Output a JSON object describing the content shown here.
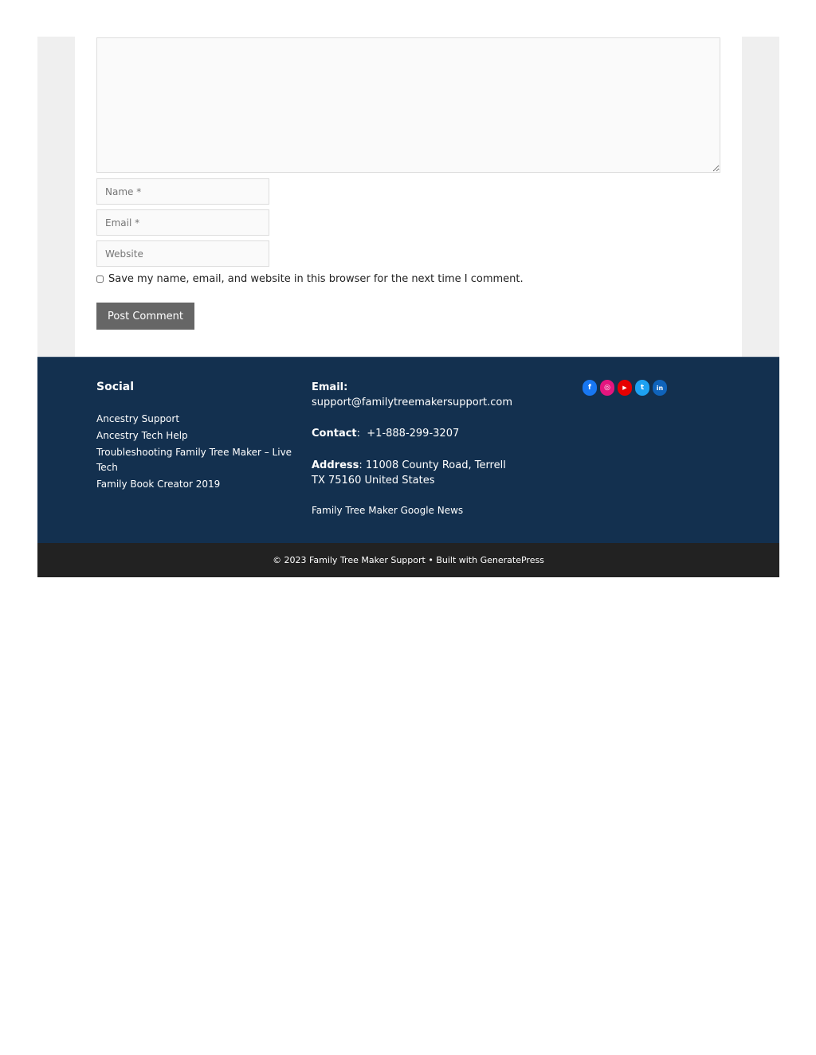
{
  "comment_form": {
    "comment_placeholder": "",
    "name_placeholder": "Name *",
    "email_placeholder": "Email *",
    "website_placeholder": "Website",
    "consent_label": "Save my name, email, and website in this browser for the next time I comment.",
    "submit_label": "Post Comment"
  },
  "footer": {
    "social": {
      "title": "Social",
      "links": [
        "Ancestry Support",
        "Ancestry Tech Help",
        "Troubleshooting Family Tree Maker – Live Tech",
        "Family Book Creator 2019"
      ]
    },
    "contact": {
      "email_label": "Email:",
      "email_value": "support@familytreemakersupport.com",
      "contact_label": "Contact",
      "contact_value": ":  +1-888-299-3207",
      "address_label": "Address",
      "address_line1": ": 11008 County Road, Terrell",
      "address_line2": "TX 75160 United States",
      "news_link": "Family Tree Maker Google News"
    },
    "social_icons": [
      {
        "name": "facebook-icon",
        "glyph": "f",
        "color": "#1877f2"
      },
      {
        "name": "instagram-icon",
        "glyph": "◎",
        "color": "#e4157f"
      },
      {
        "name": "youtube-icon",
        "glyph": "▶",
        "color": "#e60000"
      },
      {
        "name": "twitter-icon",
        "glyph": "t",
        "color": "#1da1f2"
      },
      {
        "name": "linkedin-icon",
        "glyph": "in",
        "color": "#0f63bb"
      }
    ],
    "copyright": "© 2023 Family Tree Maker Support • Built with GeneratePress"
  },
  "colors": {
    "footer_bg": "#13304f",
    "footer_bar_bg": "#222222",
    "button_bg": "#666666"
  }
}
